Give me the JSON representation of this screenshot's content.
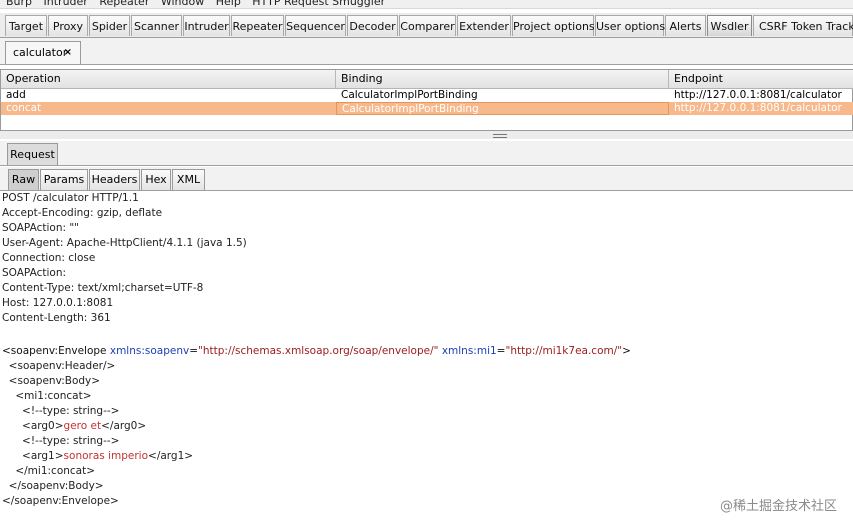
{
  "menubar": {
    "items": [
      "Burp",
      "Intruder",
      "Repeater",
      "Window",
      "Help",
      "HTTP Request Smuggler"
    ]
  },
  "tabs": [
    {
      "label": "Target"
    },
    {
      "label": "Proxy"
    },
    {
      "label": "Spider"
    },
    {
      "label": "Scanner"
    },
    {
      "label": "Intruder"
    },
    {
      "label": "Repeater"
    },
    {
      "label": "Sequencer"
    },
    {
      "label": "Decoder"
    },
    {
      "label": "Comparer"
    },
    {
      "label": "Extender"
    },
    {
      "label": "Project options"
    },
    {
      "label": "User options"
    },
    {
      "label": "Alerts"
    },
    {
      "label": "Wsdler",
      "active": true
    },
    {
      "label": "CSRF Token Tracker"
    }
  ],
  "doc_tab": {
    "label": "calculator",
    "close": "×"
  },
  "operations": {
    "headers": [
      "Operation",
      "Binding",
      "Endpoint"
    ],
    "rows": [
      {
        "operation": "add",
        "binding": "CalculatorImplPortBinding",
        "endpoint": "http://127.0.0.1:8081/calculator"
      },
      {
        "operation": "concat",
        "binding": "CalculatorImplPortBinding",
        "endpoint": "http://127.0.0.1:8081/calculator",
        "selected": true
      }
    ],
    "selected_color": "#f7b88c"
  },
  "request_tab": {
    "label": "Request"
  },
  "view_tabs": [
    {
      "label": "Raw",
      "active": true
    },
    {
      "label": "Params"
    },
    {
      "label": "Headers"
    },
    {
      "label": "Hex"
    },
    {
      "label": "XML"
    }
  ],
  "http_lines": [
    "POST /calculator HTTP/1.1",
    "Accept-Encoding: gzip, deflate",
    "SOAPAction: \"\"",
    "User-Agent: Apache-HttpClient/4.1.1 (java 1.5)",
    "Connection: close",
    "SOAPAction:",
    "Content-Type: text/xml;charset=UTF-8",
    "Host: 127.0.0.1:8081",
    "Content-Length: 361"
  ],
  "xml": {
    "envelope_open": "<soapenv:Envelope ",
    "attr1_name": "xmlns:soapenv",
    "attr1_value": "\"http://schemas.xmlsoap.org/soap/envelope/\"",
    "attr2_name": "xmlns:mi1",
    "attr2_value": "\"http://mi1k7ea.com/\"",
    "envelope_close_bracket": ">",
    "header": "  <soapenv:Header/>",
    "body_open": "  <soapenv:Body>",
    "concat_open": "    <mi1:concat>",
    "comment1": "      <!--type: string-->",
    "arg0_open": "      <arg0>",
    "arg0_value": "gero et",
    "arg0_close": "</arg0>",
    "comment2": "      <!--type: string-->",
    "arg1_open": "      <arg1>",
    "arg1_value": "sonoras imperio",
    "arg1_close": "</arg1>",
    "concat_close": "    </mi1:concat>",
    "body_close": "  </soapenv:Body>",
    "envelope_end": "</soapenv:Envelope>"
  },
  "watermark": "@稀土掘金技术社区",
  "colors": {
    "accent_selection": "#f7b88c",
    "xml_attr": "#1b3fb8",
    "xml_value": "#9b1b1b"
  }
}
